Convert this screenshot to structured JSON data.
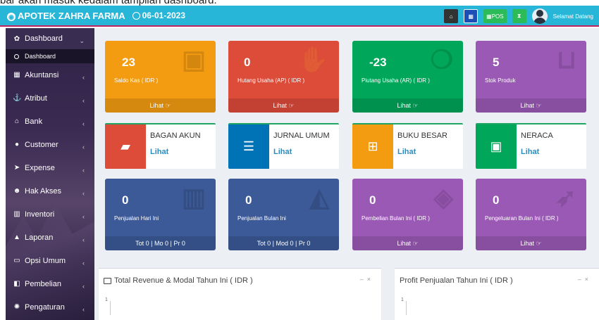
{
  "caption": "bar akan masuk kedalam tampilan dashboard.",
  "header": {
    "brand": "APOTEK ZAHRA FARMA",
    "date": "06-01-2023",
    "pos_label": "POS",
    "greeting": "Selamat Datang"
  },
  "sidebar": {
    "items": [
      {
        "label": "Dashboard",
        "icon": "dashboard-icon",
        "glyph": "✿"
      },
      {
        "label": "Akuntansi",
        "icon": "calculator-icon",
        "glyph": "▦"
      },
      {
        "label": "Atribut",
        "icon": "anchor-icon",
        "glyph": "⚓"
      },
      {
        "label": "Bank",
        "icon": "bank-icon",
        "glyph": "⌂"
      },
      {
        "label": "Customer",
        "icon": "user-icon",
        "glyph": "●"
      },
      {
        "label": "Expense",
        "icon": "send-icon",
        "glyph": "➤"
      },
      {
        "label": "Hak Akses",
        "icon": "users-icon",
        "glyph": "☻"
      },
      {
        "label": "Inventori",
        "icon": "barcode-icon",
        "glyph": "▥"
      },
      {
        "label": "Laporan",
        "icon": "chart-icon",
        "glyph": "▲"
      },
      {
        "label": "Opsi Umum",
        "icon": "laptop-icon",
        "glyph": "▭"
      },
      {
        "label": "Pembelian",
        "icon": "cart-icon",
        "glyph": "◧"
      },
      {
        "label": "Pengaturan",
        "icon": "gear-icon",
        "glyph": "✺"
      }
    ],
    "sub_dashboard": "Dashboard"
  },
  "stats_row1": [
    {
      "value": "23",
      "label": "Saldo Kas ( IDR )",
      "footer": "Lihat",
      "color": "#f39c12"
    },
    {
      "value": "0",
      "label": "Hutang Usaha (AP) ( IDR )",
      "footer": "Lihat",
      "color": "#dd4b39"
    },
    {
      "value": "-23",
      "label": "Piutang Usaha (AR) ( IDR )",
      "footer": "Lihat",
      "color": "#00a65a"
    },
    {
      "value": "5",
      "label": "Stok Produk",
      "footer": "Lihat",
      "color": "#9b59b6"
    }
  ],
  "info_boxes": [
    {
      "title": "BAGAN AKUN",
      "link": "Lihat",
      "color": "#dd4b39",
      "icon": "book-icon"
    },
    {
      "title": "JURNAL UMUM",
      "link": "Lihat",
      "color": "#0073b7",
      "icon": "list-icon"
    },
    {
      "title": "BUKU BESAR",
      "link": "Lihat",
      "color": "#f39c12",
      "icon": "calendar-icon"
    },
    {
      "title": "NERACA",
      "link": "Lihat",
      "color": "#00a65a",
      "icon": "money-icon"
    }
  ],
  "stats_row3": [
    {
      "value": "0",
      "label": "Penjualan Hari Ini",
      "footer": "Tot 0 | Mo 0 | Pr 0",
      "color": "#3c5a98"
    },
    {
      "value": "0",
      "label": "Penjualan Bulan Ini",
      "footer": "Tot 0 | Mod 0 | Pr 0",
      "color": "#3c5a98"
    },
    {
      "value": "0",
      "label": "Pembelian Bulan Ini ( IDR )",
      "footer": "Lihat",
      "color": "#9b59b6"
    },
    {
      "value": "0",
      "label": "Pengeluaran Bulan Ini ( IDR )",
      "footer": "Lihat",
      "color": "#9b59b6"
    }
  ],
  "panels": [
    {
      "title": "Total Revenue & Modal Tahun Ini ( IDR )",
      "axis_top": "1"
    },
    {
      "title": "Profit Penjualan Tahun Ini ( IDR )",
      "axis_top": "1"
    }
  ]
}
